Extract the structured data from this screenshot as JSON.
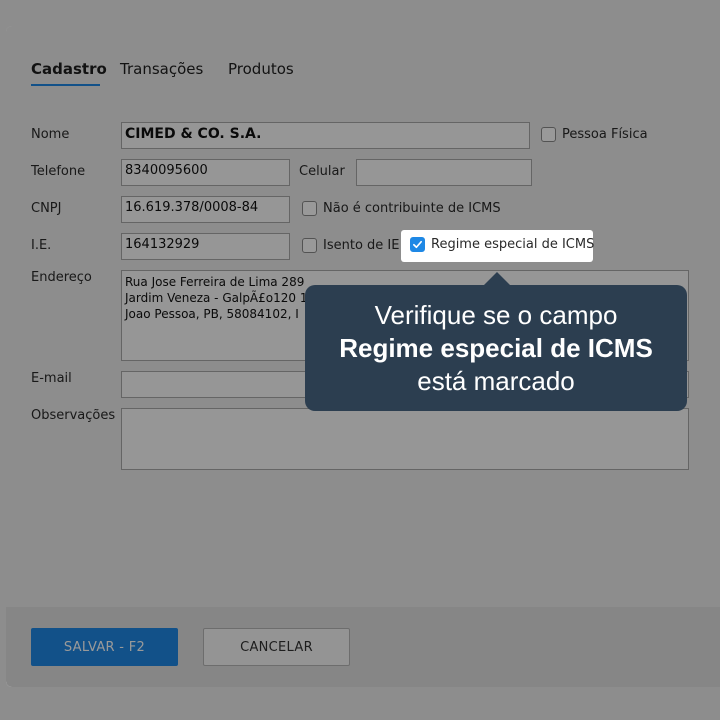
{
  "tabs": [
    {
      "label": "Cadastro",
      "active": true
    },
    {
      "label": "Transações",
      "active": false
    },
    {
      "label": "Produtos",
      "active": false
    }
  ],
  "form": {
    "nome_label": "Nome",
    "nome_value": "CIMED & CO. S.A.",
    "pessoa_fisica_label": "Pessoa Física",
    "telefone_label": "Telefone",
    "telefone_value": "8340095600",
    "celular_label": "Celular",
    "celular_value": "",
    "cnpj_label": "CNPJ",
    "cnpj_value": "16.619.378/0008-84",
    "nao_contribuinte_label": "Não é contribuinte de ICMS",
    "ie_label": "I.E.",
    "ie_value": "164132929",
    "isento_ie_label": "Isento de IE",
    "regime_especial_label": "Regime especial de ICMS",
    "regime_especial_checked": true,
    "endereco_label": "Endereço",
    "endereco_value": "Rua Jose Ferreira de Lima 289\nJardim Veneza - GalpÃ£o120 1\nJoao Pessoa, PB, 58084102, I",
    "email_label": "E-mail",
    "email_value": "",
    "observacoes_label": "Observações",
    "observacoes_value": ""
  },
  "buttons": {
    "save_label": "SALVAR - F2",
    "cancel_label": "CANCELAR"
  },
  "tooltip": {
    "line1": "Verifique se o campo",
    "line2": "Regime especial de ICMS",
    "line3": "está marcado"
  },
  "colors": {
    "accent": "#1e88e5",
    "tooltip_bg": "#2c3e50"
  }
}
